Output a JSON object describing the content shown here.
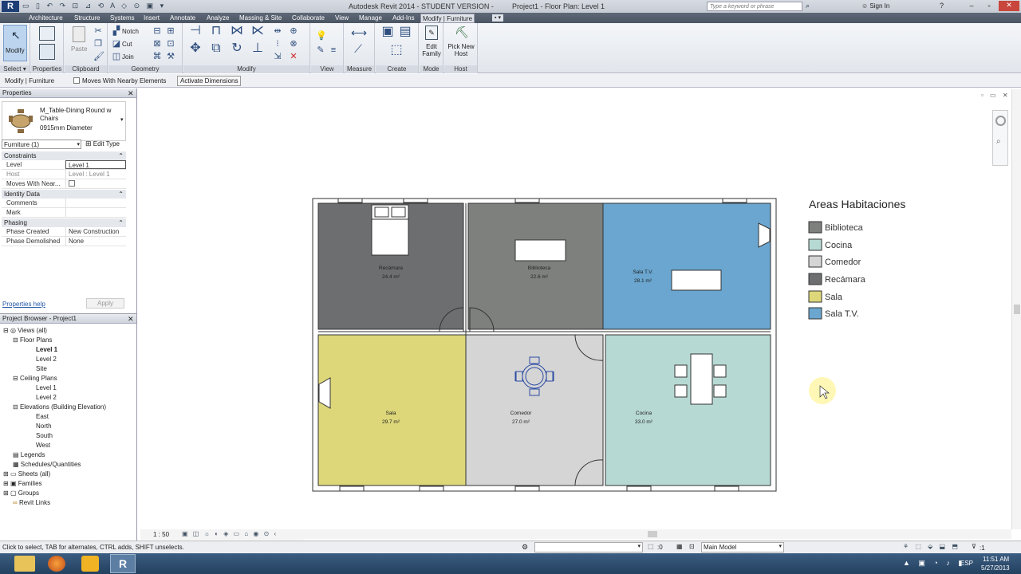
{
  "window": {
    "title": "Autodesk Revit 2014 - STUDENT VERSION -",
    "doc_title": "Project1 - Floor Plan: Level 1",
    "search_placeholder": "Type a keyword or phrase",
    "sign_in": "Sign In"
  },
  "ribbon_tabs": [
    "Architecture",
    "Structure",
    "Systems",
    "Insert",
    "Annotate",
    "Analyze",
    "Massing & Site",
    "Collaborate",
    "View",
    "Manage",
    "Add-Ins",
    "Modify | Furniture"
  ],
  "ribbon": {
    "modify_label": "Modify",
    "paste_label": "Paste",
    "notch_label": "Notch",
    "cut_label": "Cut",
    "join_label": "Join",
    "edit_family_label": "Edit Family",
    "pick_new_host_label": "Pick New Host",
    "panels": {
      "select": "Select",
      "properties": "Properties",
      "clipboard": "Clipboard",
      "geometry": "Geometry",
      "modify": "Modify",
      "view": "View",
      "measure": "Measure",
      "create": "Create",
      "mode": "Mode",
      "host": "Host"
    }
  },
  "options_bar": {
    "context": "Modify | Furniture",
    "moves_with_nearby": "Moves With Nearby Elements",
    "activate_dimensions": "Activate Dimensions"
  },
  "properties": {
    "header": "Properties",
    "type_name": "M_Table-Dining Round w Chairs",
    "type_size": "0915mm Diameter",
    "instance_filter": "Furniture (1)",
    "edit_type": "Edit Type",
    "sections": {
      "constraints": "Constraints",
      "identity": "Identity Data",
      "phasing": "Phasing"
    },
    "rows": {
      "level_k": "Level",
      "level_v": "Level 1",
      "host_k": "Host",
      "host_v": "Level : Level 1",
      "moves_k": "Moves With Near...",
      "comments_k": "Comments",
      "mark_k": "Mark",
      "phase_created_k": "Phase Created",
      "phase_created_v": "New Construction",
      "phase_demolished_k": "Phase Demolished",
      "phase_demolished_v": "None"
    },
    "help_link": "Properties help",
    "apply": "Apply"
  },
  "project_browser": {
    "header": "Project Browser - Project1",
    "views_all": "Views (all)",
    "floor_plans": "Floor Plans",
    "fp_level1": "Level 1",
    "fp_level2": "Level 2",
    "fp_site": "Site",
    "ceiling_plans": "Ceiling Plans",
    "cp_level1": "Level 1",
    "cp_level2": "Level 2",
    "elevations": "Elevations (Building Elevation)",
    "el_east": "East",
    "el_north": "North",
    "el_south": "South",
    "el_west": "West",
    "legends": "Legends",
    "schedules": "Schedules/Quantities",
    "sheets": "Sheets (all)",
    "families": "Families",
    "groups": "Groups",
    "revit_links": "Revit Links"
  },
  "floor_plan": {
    "rooms": [
      {
        "name": "Recámara",
        "area": "24.4 m²",
        "color": "#6d6e70"
      },
      {
        "name": "Biblioteca",
        "area": "22.6 m²",
        "color": "#7e807e"
      },
      {
        "name": "Sala T.V.",
        "area": "28.1 m²",
        "color": "#6aa6cf"
      },
      {
        "name": "Sala",
        "area": "29.7 m²",
        "color": "#ddd77a"
      },
      {
        "name": "Comedor",
        "area": "27.0 m²",
        "color": "#d5d5d5"
      },
      {
        "name": "Cocina",
        "area": "33.0 m²",
        "color": "#b7d9d3"
      }
    ],
    "legend_title": "Areas Habitaciones",
    "legend": [
      {
        "label": "Biblioteca",
        "color": "#7e807e"
      },
      {
        "label": "Cocina",
        "color": "#b7d9d3"
      },
      {
        "label": "Comedor",
        "color": "#d5d5d5"
      },
      {
        "label": "Recámara",
        "color": "#6d6e70"
      },
      {
        "label": "Sala",
        "color": "#ddd77a"
      },
      {
        "label": "Sala T.V.",
        "color": "#6aa6cf"
      }
    ]
  },
  "view_control": {
    "scale": "1 : 50"
  },
  "status": {
    "hint": "Click to select, TAB for alternates, CTRL adds, SHIFT unselects.",
    "selection_count": ":0",
    "model": "Main Model",
    "filter_count": ":1"
  },
  "taskbar": {
    "lang": "ESP",
    "time": "11:51 AM",
    "date": "5/27/2013"
  },
  "colors": {
    "accent": "#4b5563",
    "ribbon_active": "#dfe3ea",
    "taskbar": "#2b4a6b"
  }
}
